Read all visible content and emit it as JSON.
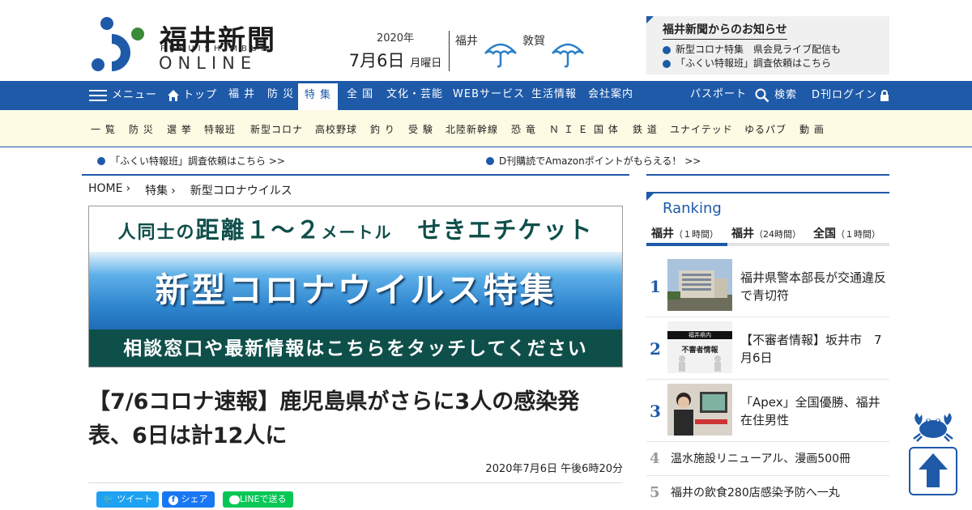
{
  "logo": {
    "name": "福井新聞",
    "sub": "FUKUISHIMBUN",
    "online": "ONLINE"
  },
  "date": {
    "year": "2020年",
    "day": "7月6日",
    "dow": "月曜日"
  },
  "weather": [
    {
      "city": "福井",
      "icon": "umbrella-icon"
    },
    {
      "city": "敦賀",
      "icon": "umbrella-icon"
    }
  ],
  "notice": {
    "title": "福井新聞からのお知らせ",
    "items": [
      "新型コロナ特集　県会見ライブ配信も",
      "「ふくい特報班」調査依頼はこちら"
    ]
  },
  "nav": {
    "menu": "メニュー",
    "top": "トップ",
    "items": [
      "福 井",
      "防 災",
      "特 集",
      "全 国",
      "文化・芸能",
      "WEBサービス",
      "生活情報",
      "会社案内"
    ],
    "passport": "パスポート",
    "search": "検索",
    "login": "D刊ログイン"
  },
  "subnav": [
    "一 覧",
    "防 災",
    "選 挙",
    "特報班",
    "新型コロナ",
    "高校野球",
    "釣 り",
    "受 験",
    "北陸新幹線",
    "恐 竜",
    "Ｎ Ｉ Ｅ",
    "国 体",
    "鉄 道",
    "ユナイテッド",
    "ゆるパブ",
    "動 画"
  ],
  "banner_links": [
    "「ふくい特報班」調査依頼はこちら >>",
    "D刊購読でAmazonポイントがもらえる！ >>"
  ],
  "breadcrumb": [
    "HOME",
    "特集",
    "新型コロナウイルス"
  ],
  "corona_banner": {
    "top_a": "人同士の",
    "top_b": "距離１～２",
    "top_c": "メートル",
    "top_d": "　せきエチケット",
    "middle": "新型コロナウイルス特集",
    "bottom": "相談窓口や最新情報はこちらをタッチしてください"
  },
  "article": {
    "headline": "【7/6コロナ速報】鹿児島県がさらに3人の感染発表、6日は計12人に",
    "date": "2020年7月6日 午後6時20分"
  },
  "share": {
    "twitter": "ツイート",
    "facebook": "シェア",
    "line": "LINEで送る"
  },
  "ranking": {
    "title": "Ranking",
    "tabs": [
      {
        "name": "福井",
        "span": "（１時間）"
      },
      {
        "name": "福井",
        "span": "（24時間）"
      },
      {
        "name": "全国",
        "span": "（１時間）"
      }
    ],
    "items": [
      {
        "rank": "1",
        "title": "福井県警本部長が交通違反で青切符"
      },
      {
        "rank": "2",
        "title": "【不審者情報】坂井市　7月6日",
        "thumb_text_a": "福井県内",
        "thumb_text_b": "不審者情報"
      },
      {
        "rank": "3",
        "title": "「Apex」全国優勝、福井在住男性"
      },
      {
        "rank": "4",
        "title": "温水施設リニューアル、漫画500冊"
      },
      {
        "rank": "5",
        "title": "福井の飲食280店感染予防へ一丸"
      }
    ]
  },
  "colors": {
    "brand_blue": "#1e5aa8",
    "subnav_bg": "#fdfbe3",
    "banner_green": "#0f4f4a",
    "twitter": "#1da1f2",
    "facebook": "#1877f2",
    "line": "#06c755"
  }
}
